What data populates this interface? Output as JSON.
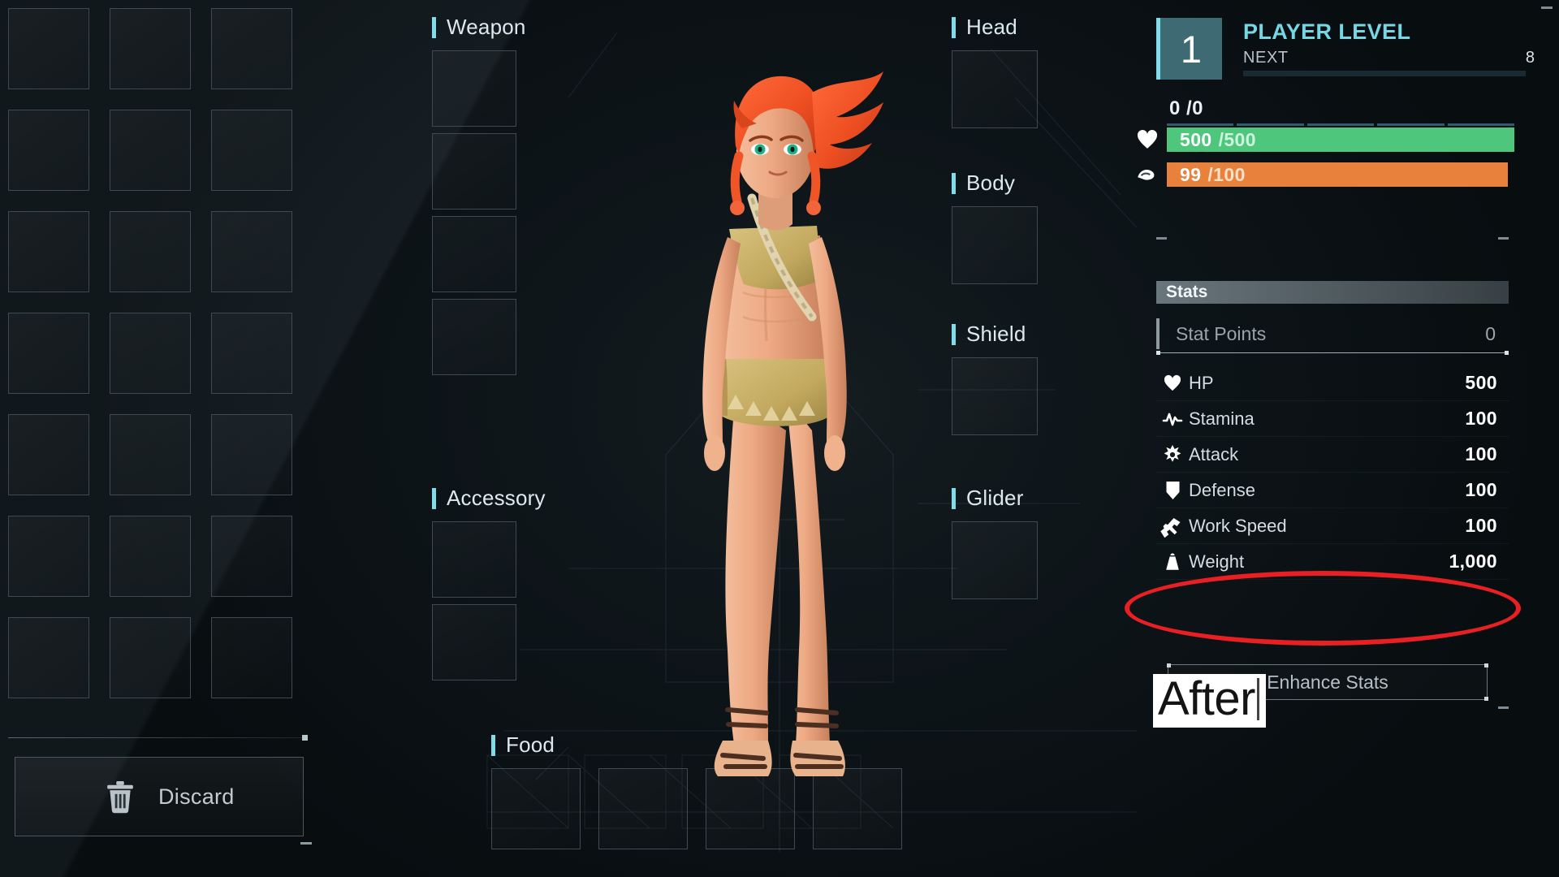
{
  "inventory": {
    "rows": 7,
    "cols": 3,
    "slot_count": 21,
    "empty": true
  },
  "discard": {
    "label": "Discard",
    "icon": "trash-icon"
  },
  "equipment": {
    "weapon": {
      "label": "Weapon",
      "slots": 4
    },
    "accessory": {
      "label": "Accessory",
      "slots": 2
    },
    "food": {
      "label": "Food",
      "slots": 4
    },
    "head": {
      "label": "Head",
      "slots": 1
    },
    "body": {
      "label": "Body",
      "slots": 1
    },
    "shield": {
      "label": "Shield",
      "slots": 1
    },
    "glider": {
      "label": "Glider",
      "slots": 1
    }
  },
  "player": {
    "level_title": "PLAYER LEVEL",
    "level_value": "1",
    "next_label": "NEXT",
    "next_value": "8",
    "xp_text": "0 /0",
    "hp_current": "500",
    "hp_max": "/500",
    "stamina_current": "99",
    "stamina_max": "/100"
  },
  "stats": {
    "header": "Stats",
    "stat_points_label": "Stat Points",
    "stat_points_value": "0",
    "rows": [
      {
        "icon": "heart-icon",
        "name": "HP",
        "value": "500"
      },
      {
        "icon": "pulse-icon",
        "name": "Stamina",
        "value": "100"
      },
      {
        "icon": "burst-icon",
        "name": "Attack",
        "value": "100"
      },
      {
        "icon": "shield-icon",
        "name": "Defense",
        "value": "100"
      },
      {
        "icon": "hammer-icon",
        "name": "Work Speed",
        "value": "100"
      },
      {
        "icon": "weight-icon",
        "name": "Weight",
        "value": "1,000"
      }
    ],
    "enhance_label": "Enhance Stats"
  },
  "annotations": {
    "highlight_target": "Weight",
    "highlight_color": "#e81f23",
    "text_overlay": "After"
  },
  "colors": {
    "accent_cyan": "#7fdce8",
    "hp_green": "#4ec77d",
    "stamina_orange": "#e8813c",
    "panel_bg": "#131d23",
    "level_badge": "#3e6a73"
  }
}
